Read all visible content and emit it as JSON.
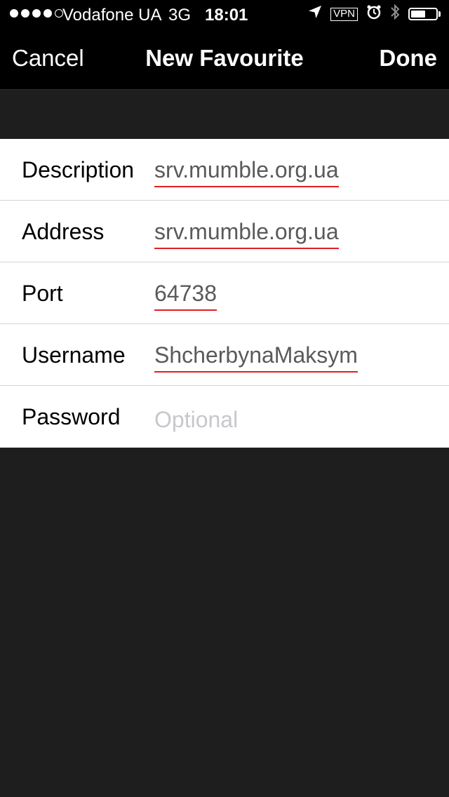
{
  "status_bar": {
    "signal_dots_filled": 4,
    "signal_dots_total": 5,
    "carrier": "Vodafone UA",
    "network": "3G",
    "time": "18:01",
    "vpn": "VPN",
    "icons": [
      "location-icon",
      "vpn-icon",
      "alarm-icon",
      "bluetooth-icon",
      "battery-icon"
    ],
    "battery_level": 0.6
  },
  "nav": {
    "cancel": "Cancel",
    "title": "New Favourite",
    "done": "Done"
  },
  "form": {
    "rows": [
      {
        "label": "Description",
        "value": "srv.mumble.org.ua"
      },
      {
        "label": "Address",
        "value": "srv.mumble.org.ua"
      },
      {
        "label": "Port",
        "value": "64738"
      },
      {
        "label": "Username",
        "value": "ShcherbynaMaksym"
      },
      {
        "label": "Password",
        "placeholder": "Optional"
      }
    ]
  },
  "colors": {
    "background": "#1e1e1e",
    "bar": "#000000",
    "spellcheck_underline": "#e02020",
    "placeholder": "#c7c7cd"
  }
}
